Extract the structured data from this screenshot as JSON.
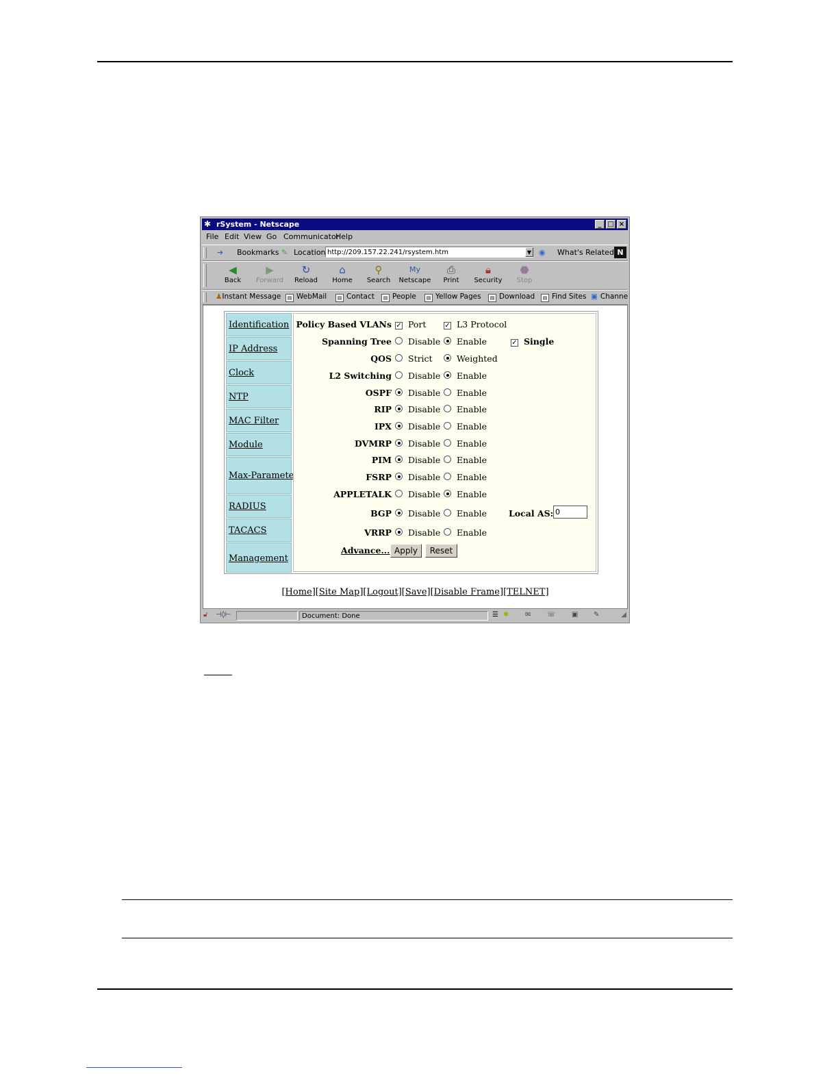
{
  "window": {
    "title": "rSystem - Netscape",
    "controls": [
      "_",
      "□",
      "×"
    ]
  },
  "menu": [
    "File",
    "Edit",
    "View",
    "Go",
    "Communicator",
    "Help"
  ],
  "location_bar": {
    "bookmarks_label": "Bookmarks",
    "location_label": "Location:",
    "url": "http://209.157.22.241/rsystem.htm",
    "whats_related": "What's Related",
    "logo": "N"
  },
  "nav_toolbar": [
    {
      "label": "Back",
      "icon": "back-arrow-icon",
      "enabled": true
    },
    {
      "label": "Forward",
      "icon": "forward-arrow-icon",
      "enabled": false
    },
    {
      "label": "Reload",
      "icon": "reload-icon",
      "enabled": true
    },
    {
      "label": "Home",
      "icon": "home-icon",
      "enabled": true
    },
    {
      "label": "Search",
      "icon": "search-icon",
      "enabled": true
    },
    {
      "label": "Netscape",
      "icon": "my-netscape-icon",
      "enabled": true
    },
    {
      "label": "Print",
      "icon": "print-icon",
      "enabled": true
    },
    {
      "label": "Security",
      "icon": "lock-icon",
      "enabled": true
    },
    {
      "label": "Stop",
      "icon": "stop-icon",
      "enabled": false
    }
  ],
  "personal_toolbar": [
    "Instant Message",
    "WebMail",
    "Contact",
    "People",
    "Yellow Pages",
    "Download",
    "Find Sites",
    "Channe"
  ],
  "sidebar": [
    "Identification",
    "IP Address",
    "Clock",
    "NTP",
    "MAC Filter",
    "Module",
    "Max-Parameter",
    "RADIUS",
    "TACACS",
    "Management"
  ],
  "form": {
    "policy_vlans": {
      "label": "Policy Based VLANs",
      "port": "Port",
      "l3": "L3 Protocol"
    },
    "rows": [
      {
        "label": "Spanning Tree",
        "opt1": "Disable",
        "opt2": "Enable",
        "selected": 2
      },
      {
        "label": "QOS",
        "opt1": "Strict",
        "opt2": "Weighted",
        "selected": 2
      },
      {
        "label": "L2 Switching",
        "opt1": "Disable",
        "opt2": "Enable",
        "selected": 2
      },
      {
        "label": "OSPF",
        "opt1": "Disable",
        "opt2": "Enable",
        "selected": 1
      },
      {
        "label": "RIP",
        "opt1": "Disable",
        "opt2": "Enable",
        "selected": 1
      },
      {
        "label": "IPX",
        "opt1": "Disable",
        "opt2": "Enable",
        "selected": 1
      },
      {
        "label": "DVMRP",
        "opt1": "Disable",
        "opt2": "Enable",
        "selected": 1
      },
      {
        "label": "PIM",
        "opt1": "Disable",
        "opt2": "Enable",
        "selected": 1
      },
      {
        "label": "FSRP",
        "opt1": "Disable",
        "opt2": "Enable",
        "selected": 1
      },
      {
        "label": "APPLETALK",
        "opt1": "Disable",
        "opt2": "Enable",
        "selected": 2
      },
      {
        "label": "BGP",
        "opt1": "Disable",
        "opt2": "Enable",
        "selected": 1
      },
      {
        "label": "VRRP",
        "opt1": "Disable",
        "opt2": "Enable",
        "selected": 1
      }
    ],
    "single_label": "Single",
    "local_as_label": "Local AS:",
    "local_as_value": "0",
    "advance_link": "Advance...",
    "apply_button": "Apply",
    "reset_button": "Reset"
  },
  "footer_links": "[Home][Site Map][Logout][Save][Disable Frame][TELNET]",
  "status": {
    "text": "Document: Done"
  }
}
